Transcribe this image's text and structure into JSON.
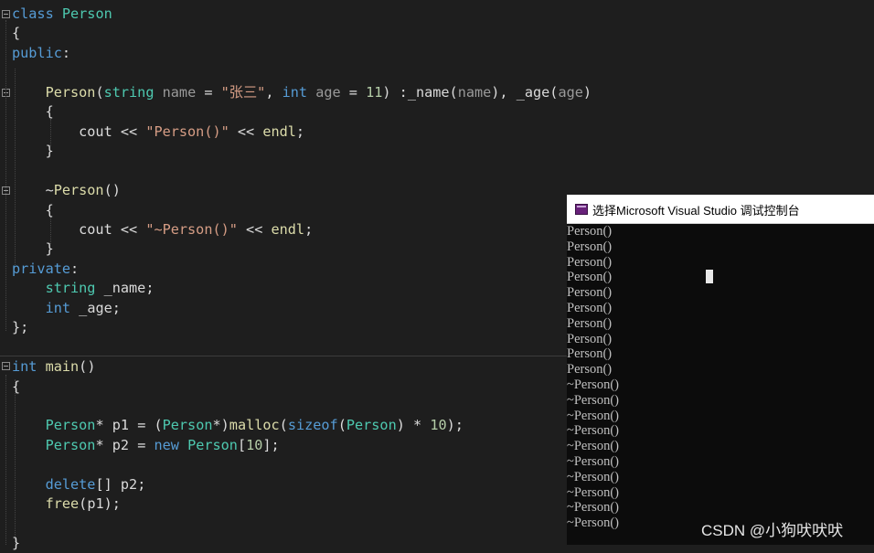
{
  "code": {
    "lines": [
      [
        {
          "c": "kw",
          "t": "class"
        },
        {
          "c": "pl",
          "t": " "
        },
        {
          "c": "ty",
          "t": "Person"
        }
      ],
      [
        {
          "c": "pl",
          "t": "{"
        }
      ],
      [
        {
          "c": "kw",
          "t": "public"
        },
        {
          "c": "pl",
          "t": ":"
        }
      ],
      [],
      [
        {
          "c": "pl",
          "t": "    "
        },
        {
          "c": "fn",
          "t": "Person"
        },
        {
          "c": "pl",
          "t": "("
        },
        {
          "c": "ty",
          "t": "string"
        },
        {
          "c": "pl",
          "t": " "
        },
        {
          "c": "pm",
          "t": "name"
        },
        {
          "c": "pl",
          "t": " = "
        },
        {
          "c": "st",
          "t": "\"张三\""
        },
        {
          "c": "pl",
          "t": ", "
        },
        {
          "c": "kw",
          "t": "int"
        },
        {
          "c": "pl",
          "t": " "
        },
        {
          "c": "pm",
          "t": "age"
        },
        {
          "c": "pl",
          "t": " = "
        },
        {
          "c": "nu",
          "t": "11"
        },
        {
          "c": "pl",
          "t": ") :"
        },
        {
          "c": "vr",
          "t": "_name"
        },
        {
          "c": "pl",
          "t": "("
        },
        {
          "c": "pm",
          "t": "name"
        },
        {
          "c": "pl",
          "t": "), "
        },
        {
          "c": "vr",
          "t": "_age"
        },
        {
          "c": "pl",
          "t": "("
        },
        {
          "c": "pm",
          "t": "age"
        },
        {
          "c": "pl",
          "t": ")"
        }
      ],
      [
        {
          "c": "pl",
          "t": "    {"
        }
      ],
      [
        {
          "c": "pl",
          "t": "        cout << "
        },
        {
          "c": "st",
          "t": "\"Person()\""
        },
        {
          "c": "pl",
          "t": " << "
        },
        {
          "c": "fn",
          "t": "endl"
        },
        {
          "c": "pl",
          "t": ";"
        }
      ],
      [
        {
          "c": "pl",
          "t": "    }"
        }
      ],
      [],
      [
        {
          "c": "pl",
          "t": "    ~"
        },
        {
          "c": "fn",
          "t": "Person"
        },
        {
          "c": "pl",
          "t": "()"
        }
      ],
      [
        {
          "c": "pl",
          "t": "    {"
        }
      ],
      [
        {
          "c": "pl",
          "t": "        cout << "
        },
        {
          "c": "st",
          "t": "\"~Person()\""
        },
        {
          "c": "pl",
          "t": " << "
        },
        {
          "c": "fn",
          "t": "endl"
        },
        {
          "c": "pl",
          "t": ";"
        }
      ],
      [
        {
          "c": "pl",
          "t": "    }"
        }
      ],
      [
        {
          "c": "kw",
          "t": "private"
        },
        {
          "c": "pl",
          "t": ":"
        }
      ],
      [
        {
          "c": "pl",
          "t": "    "
        },
        {
          "c": "ty",
          "t": "string"
        },
        {
          "c": "pl",
          "t": " "
        },
        {
          "c": "vr",
          "t": "_name"
        },
        {
          "c": "pl",
          "t": ";"
        }
      ],
      [
        {
          "c": "pl",
          "t": "    "
        },
        {
          "c": "kw",
          "t": "int"
        },
        {
          "c": "pl",
          "t": " "
        },
        {
          "c": "vr",
          "t": "_age"
        },
        {
          "c": "pl",
          "t": ";"
        }
      ],
      [
        {
          "c": "pl",
          "t": "};"
        }
      ],
      [],
      [
        {
          "c": "kw",
          "t": "int"
        },
        {
          "c": "pl",
          "t": " "
        },
        {
          "c": "fn",
          "t": "main"
        },
        {
          "c": "pl",
          "t": "()"
        }
      ],
      [
        {
          "c": "pl",
          "t": "{"
        }
      ],
      [],
      [
        {
          "c": "pl",
          "t": "    "
        },
        {
          "c": "ty",
          "t": "Person"
        },
        {
          "c": "pl",
          "t": "* "
        },
        {
          "c": "vr",
          "t": "p1"
        },
        {
          "c": "pl",
          "t": " = ("
        },
        {
          "c": "ty",
          "t": "Person"
        },
        {
          "c": "pl",
          "t": "*)"
        },
        {
          "c": "fn",
          "t": "malloc"
        },
        {
          "c": "pl",
          "t": "("
        },
        {
          "c": "kw",
          "t": "sizeof"
        },
        {
          "c": "pl",
          "t": "("
        },
        {
          "c": "ty",
          "t": "Person"
        },
        {
          "c": "pl",
          "t": ") * "
        },
        {
          "c": "nu",
          "t": "10"
        },
        {
          "c": "pl",
          "t": ");"
        }
      ],
      [
        {
          "c": "pl",
          "t": "    "
        },
        {
          "c": "ty",
          "t": "Person"
        },
        {
          "c": "pl",
          "t": "* "
        },
        {
          "c": "vr",
          "t": "p2"
        },
        {
          "c": "pl",
          "t": " = "
        },
        {
          "c": "kw",
          "t": "new"
        },
        {
          "c": "pl",
          "t": " "
        },
        {
          "c": "ty",
          "t": "Person"
        },
        {
          "c": "pl",
          "t": "["
        },
        {
          "c": "nu",
          "t": "10"
        },
        {
          "c": "pl",
          "t": "];"
        }
      ],
      [],
      [
        {
          "c": "pl",
          "t": "    "
        },
        {
          "c": "kw",
          "t": "delete"
        },
        {
          "c": "pl",
          "t": "[] "
        },
        {
          "c": "vr",
          "t": "p2"
        },
        {
          "c": "pl",
          "t": ";"
        }
      ],
      [
        {
          "c": "pl",
          "t": "    "
        },
        {
          "c": "fn",
          "t": "free"
        },
        {
          "c": "pl",
          "t": "("
        },
        {
          "c": "vr",
          "t": "p1"
        },
        {
          "c": "pl",
          "t": ");"
        }
      ],
      [],
      [
        {
          "c": "pl",
          "t": "}"
        }
      ]
    ]
  },
  "console": {
    "title": "选择Microsoft Visual Studio 调试控制台",
    "output": [
      "Person()",
      "Person()",
      "Person()",
      "Person()",
      "Person()",
      "Person()",
      "Person()",
      "Person()",
      "Person()",
      "Person()",
      "~Person()",
      "~Person()",
      "~Person()",
      "~Person()",
      "~Person()",
      "~Person()",
      "~Person()",
      "~Person()",
      "~Person()",
      "~Person()"
    ]
  },
  "watermark": "CSDN @小狗吠吠吠"
}
